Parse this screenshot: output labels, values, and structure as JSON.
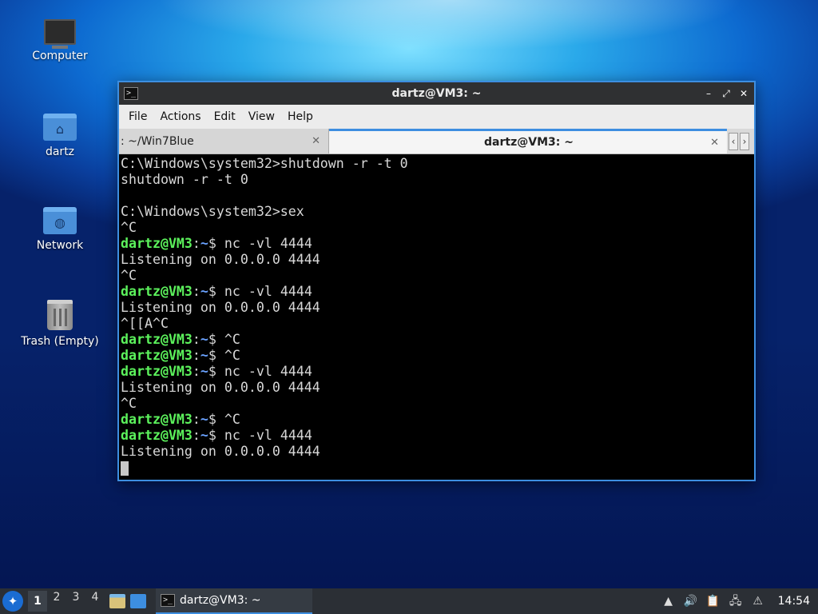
{
  "desktop": {
    "icons": [
      {
        "label": "Computer",
        "icon": "computer-icon"
      },
      {
        "label": "dartz",
        "icon": "home-folder-icon"
      },
      {
        "label": "Network",
        "icon": "network-folder-icon"
      },
      {
        "label": "Trash (Empty)",
        "icon": "trash-icon"
      }
    ]
  },
  "window": {
    "title": "dartz@VM3: ~",
    "controls": {
      "minimize": "–",
      "maximize": "⤢",
      "close": "✕"
    },
    "menu": [
      "File",
      "Actions",
      "Edit",
      "View",
      "Help"
    ],
    "tabs": [
      {
        "label": ": ~/Win7Blue",
        "active": false
      },
      {
        "label": "dartz@VM3: ~",
        "active": true
      }
    ],
    "tab_close": "✕",
    "tab_nav": {
      "left": "‹",
      "right": "›"
    }
  },
  "terminal": {
    "user_host": "dartz@VM3",
    "colon": ":",
    "path": "~",
    "dollar": "$",
    "lines": [
      {
        "kind": "text",
        "text": "C:\\Windows\\system32>shutdown -r -t 0"
      },
      {
        "kind": "text",
        "text": "shutdown -r -t 0"
      },
      {
        "kind": "text",
        "text": ""
      },
      {
        "kind": "text",
        "text": "C:\\Windows\\system32>sex"
      },
      {
        "kind": "text",
        "text": "^C"
      },
      {
        "kind": "prompt",
        "cmd": " nc -vl 4444"
      },
      {
        "kind": "text",
        "text": "Listening on 0.0.0.0 4444"
      },
      {
        "kind": "text",
        "text": "^C"
      },
      {
        "kind": "prompt",
        "cmd": " nc -vl 4444"
      },
      {
        "kind": "text",
        "text": "Listening on 0.0.0.0 4444"
      },
      {
        "kind": "text",
        "text": "^[[A^C"
      },
      {
        "kind": "prompt",
        "cmd": " ^C"
      },
      {
        "kind": "prompt",
        "cmd": " ^C"
      },
      {
        "kind": "prompt",
        "cmd": " nc -vl 4444"
      },
      {
        "kind": "text",
        "text": "Listening on 0.0.0.0 4444"
      },
      {
        "kind": "text",
        "text": "^C"
      },
      {
        "kind": "prompt",
        "cmd": " ^C"
      },
      {
        "kind": "prompt",
        "cmd": " nc -vl 4444"
      },
      {
        "kind": "text",
        "text": "Listening on 0.0.0.0 4444"
      },
      {
        "kind": "cursor"
      }
    ]
  },
  "taskbar": {
    "workspaces": [
      "1",
      "2",
      "3",
      "4"
    ],
    "current_workspace": "1",
    "task_label": "dartz@VM3: ~",
    "clock": "14:54",
    "accent": "#3d8ee0"
  }
}
